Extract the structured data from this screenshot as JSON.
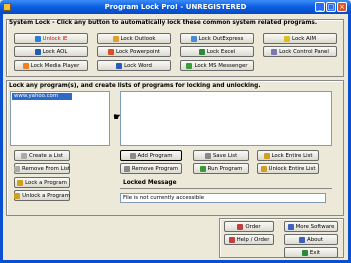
{
  "window": {
    "title": "Program Lock Pro! - UNREGISTERED"
  },
  "system_lock": {
    "heading": "System Lock - Click any button to automatically lock these common system related programs.",
    "buttons": [
      {
        "label": "Unlock IE",
        "icon": "ie-icon",
        "color": "#c81414"
      },
      {
        "label": "Lock Outlook",
        "icon": "outlook-icon"
      },
      {
        "label": "Lock OutExpress",
        "icon": "outlook-express-icon"
      },
      {
        "label": "Lock AIM",
        "icon": "aim-icon"
      },
      {
        "label": "Lock AOL",
        "icon": "aol-icon"
      },
      {
        "label": "Lock Powerpoint",
        "icon": "powerpoint-icon"
      },
      {
        "label": "Lock Excel",
        "icon": "excel-icon"
      },
      {
        "label": "Lock Control Panel",
        "icon": "control-panel-icon"
      },
      {
        "label": "Lock Media Player",
        "icon": "media-player-icon"
      },
      {
        "label": "Lock Word",
        "icon": "word-icon"
      },
      {
        "label": "Lock MS Messenger",
        "icon": "messenger-icon"
      }
    ]
  },
  "program_lists": {
    "heading": "Lock any program(s), and create lists of programs for locking and unlocking.",
    "left_list_items": [
      "www.yahoo.com"
    ],
    "left_buttons": [
      "Create a List",
      "Remove From List",
      "Lock a Program",
      "Unlock a Program"
    ],
    "right_buttons": [
      "Add Program",
      "Save List",
      "Lock Entire List",
      "Remove Program",
      "Run Program",
      "Unlock Entire List"
    ]
  },
  "locked_message": {
    "heading": "Locked Message",
    "value": "File is not currently accessible"
  },
  "footer_buttons": [
    "Order",
    "More Software",
    "Help / Order",
    "About",
    "Exit"
  ]
}
